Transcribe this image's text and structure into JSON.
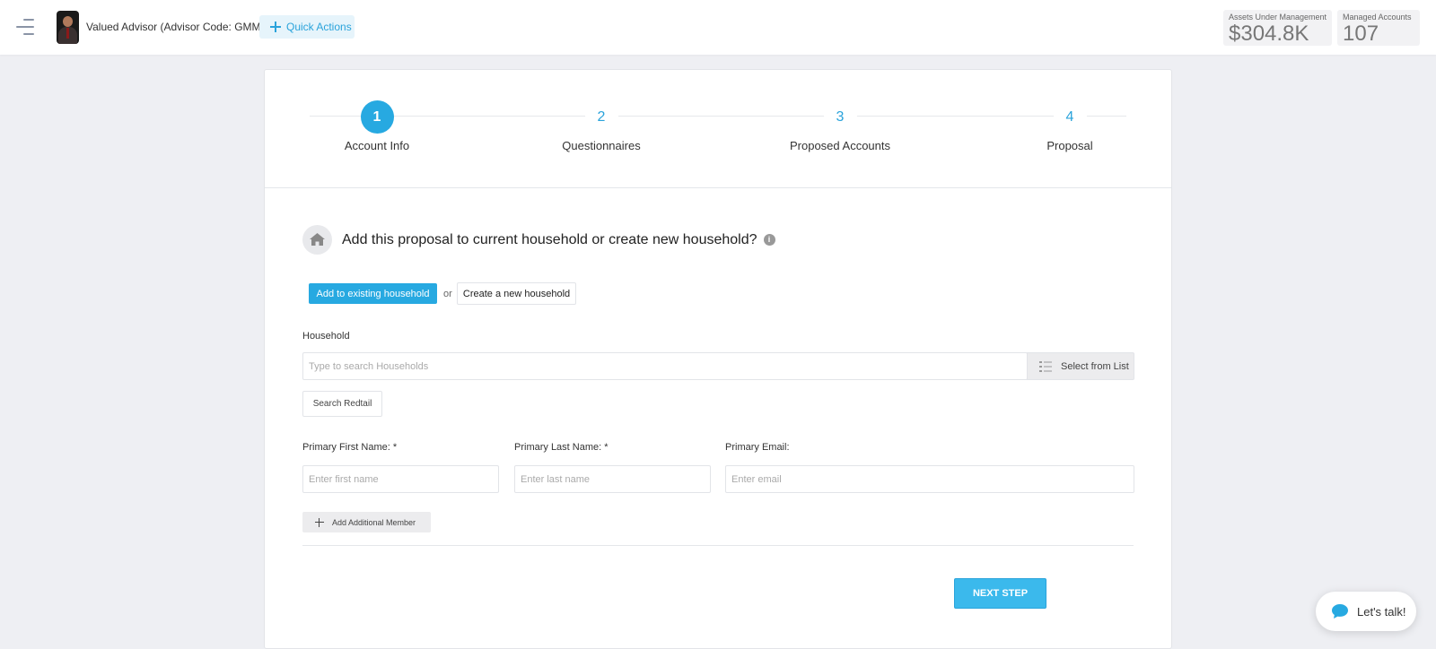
{
  "header": {
    "advisor_label": "Valued Advisor (Advisor Code: GMM)",
    "quick_actions_label": "Quick Actions",
    "stats": [
      {
        "label": "Assets Under Management",
        "value": "$304.8K"
      },
      {
        "label": "Managed Accounts",
        "value": "107"
      }
    ]
  },
  "stepper": {
    "steps": [
      {
        "number": "1",
        "label": "Account Info",
        "active": true
      },
      {
        "number": "2",
        "label": "Questionnaires",
        "active": false
      },
      {
        "number": "3",
        "label": "Proposed Accounts",
        "active": false
      },
      {
        "number": "4",
        "label": "Proposal",
        "active": false
      }
    ]
  },
  "form": {
    "question": "Add this proposal to current household or create new household?",
    "info_glyph": "i",
    "add_existing_label": "Add to existing household",
    "or_text": "or",
    "create_new_label": "Create a new household",
    "household_label": "Household",
    "household_placeholder": "Type to search Households",
    "select_from_list_label": "Select from List",
    "search_redtail_label": "Search Redtail",
    "first_name": {
      "label": "Primary First Name: *",
      "placeholder": "Enter first name"
    },
    "last_name": {
      "label": "Primary Last Name: *",
      "placeholder": "Enter last name"
    },
    "email": {
      "label": "Primary Email:",
      "placeholder": "Enter email"
    },
    "add_member_label": "Add Additional Member",
    "next_step_label": "NEXT STEP"
  },
  "chat": {
    "label": "Let's talk!"
  },
  "colors": {
    "accent": "#27a9e1",
    "page_bg": "#eeeff3",
    "card_bg": "#ffffff"
  },
  "icons": [
    "menu-icon",
    "plus-icon",
    "house-icon",
    "info-icon",
    "list-icon",
    "chat-bubble-icon"
  ]
}
